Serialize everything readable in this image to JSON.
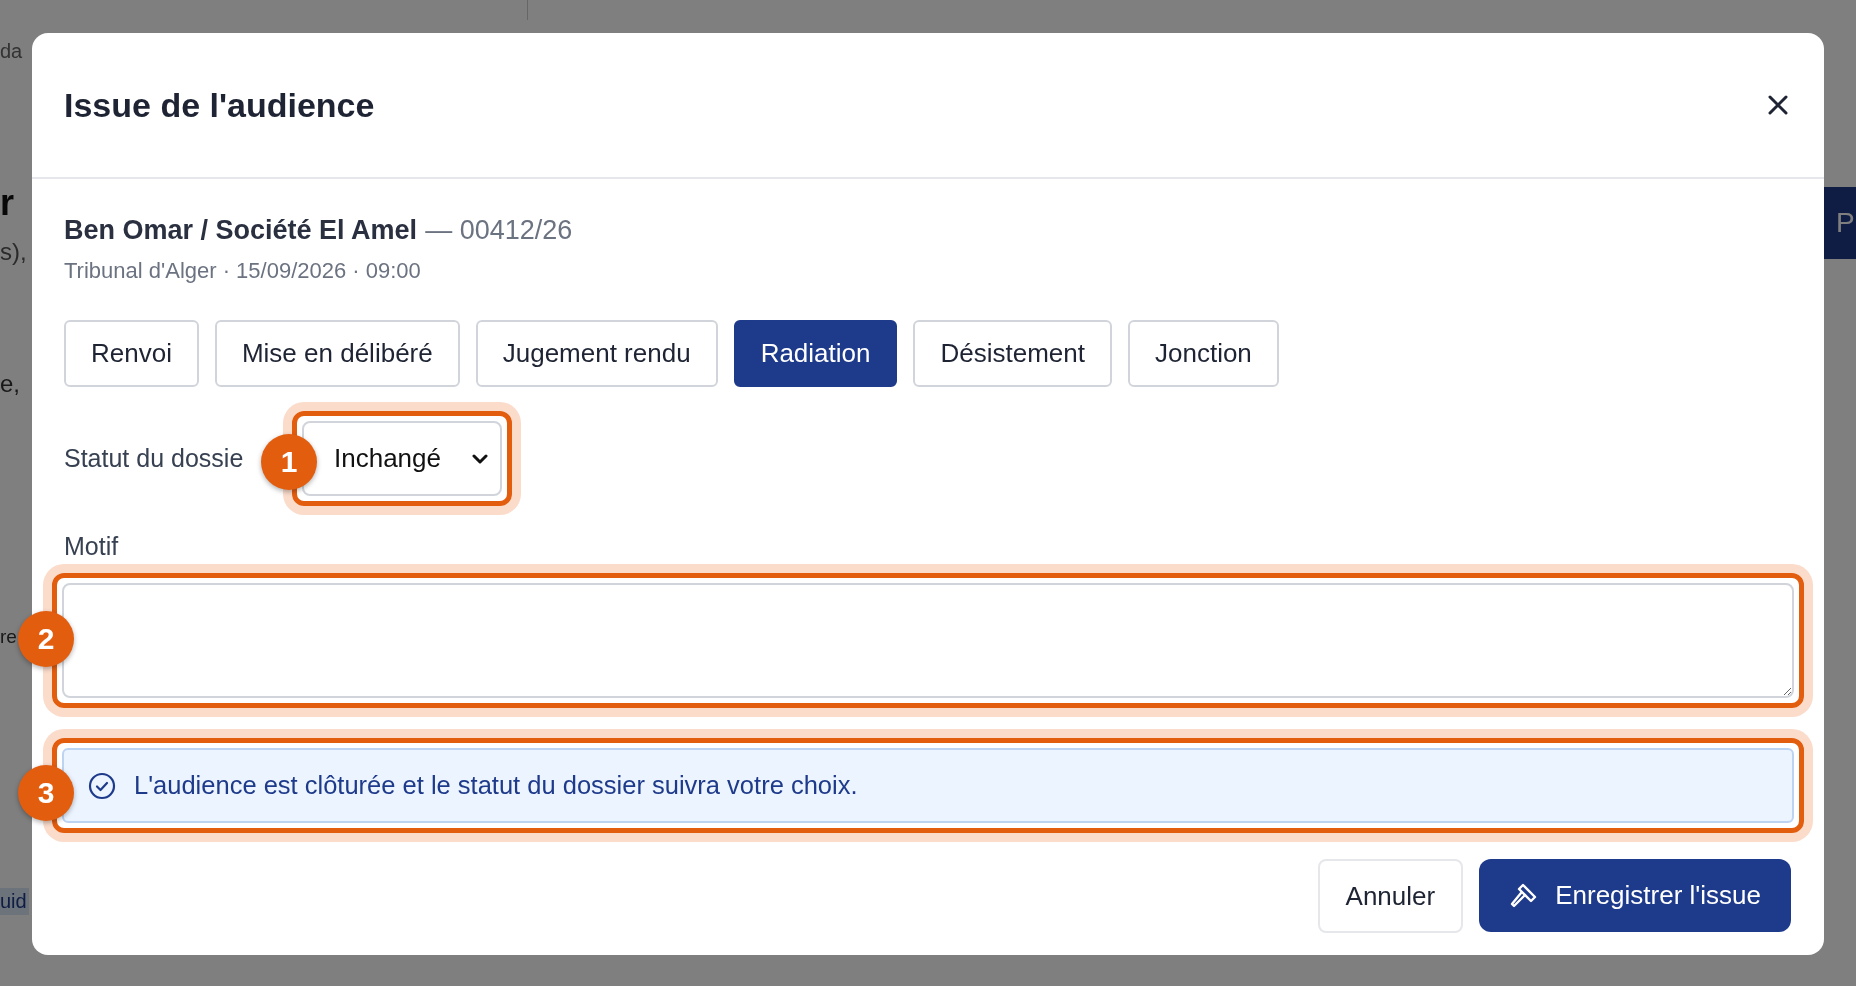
{
  "background": {
    "fragments": [
      "da",
      "r",
      "s),",
      "e,",
      "re",
      "uid"
    ],
    "side_button": "P"
  },
  "dialog": {
    "title": "Issue de l'audience",
    "case": {
      "parties": "Ben Omar / Société El Amel",
      "number": "— 00412/26",
      "details": "Tribunal d'Alger · 15/09/2026 · 09:00"
    },
    "outcomes": [
      {
        "label": "Renvoi",
        "selected": false
      },
      {
        "label": "Mise en délibéré",
        "selected": false
      },
      {
        "label": "Jugement rendu",
        "selected": false
      },
      {
        "label": "Radiation",
        "selected": true
      },
      {
        "label": "Désistement",
        "selected": false
      },
      {
        "label": "Jonction",
        "selected": false
      }
    ],
    "status": {
      "label": "Statut du dossie",
      "value": "Inchangé"
    },
    "motif": {
      "label": "Motif"
    },
    "info": "L'audience est clôturée et le statut du dossier suivra votre choix.",
    "buttons": {
      "cancel": "Annuler",
      "save": "Enregistrer l'issue"
    }
  },
  "annotations": [
    "1",
    "2",
    "3"
  ]
}
